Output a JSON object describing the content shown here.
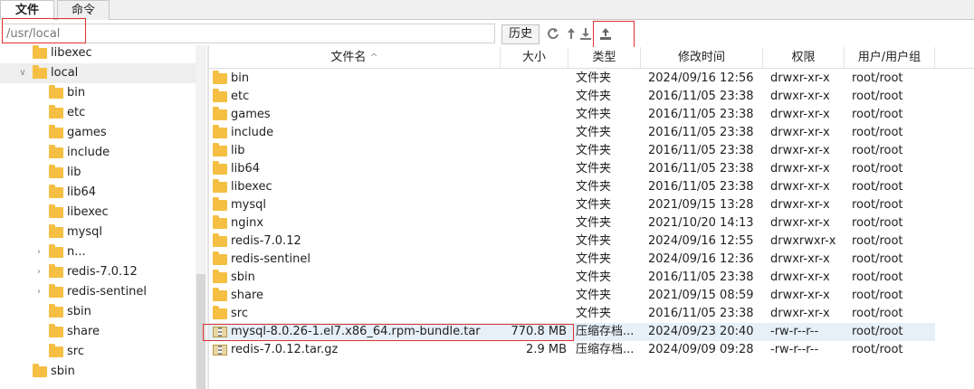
{
  "tabs": [
    "文件",
    "命令"
  ],
  "toolbar": {
    "path": "/usr/local",
    "history_label": "历史",
    "icons": [
      "refresh-icon",
      "up-arrow-icon",
      "download-icon",
      "upload-icon"
    ]
  },
  "tree": {
    "items": [
      {
        "label": "libexec",
        "level": 1,
        "caret": ""
      },
      {
        "label": "local",
        "level": 1,
        "caret": "open",
        "selected": true
      },
      {
        "label": "bin",
        "level": 2,
        "caret": ""
      },
      {
        "label": "etc",
        "level": 2,
        "caret": ""
      },
      {
        "label": "games",
        "level": 2,
        "caret": ""
      },
      {
        "label": "include",
        "level": 2,
        "caret": ""
      },
      {
        "label": "lib",
        "level": 2,
        "caret": ""
      },
      {
        "label": "lib64",
        "level": 2,
        "caret": ""
      },
      {
        "label": "libexec",
        "level": 2,
        "caret": ""
      },
      {
        "label": "mysql",
        "level": 2,
        "caret": ""
      },
      {
        "label": "n...",
        "level": 2,
        "caret": "closed"
      },
      {
        "label": "redis-7.0.12",
        "level": 2,
        "caret": "closed"
      },
      {
        "label": "redis-sentinel",
        "level": 2,
        "caret": "closed"
      },
      {
        "label": "sbin",
        "level": 2,
        "caret": ""
      },
      {
        "label": "share",
        "level": 2,
        "caret": ""
      },
      {
        "label": "src",
        "level": 2,
        "caret": ""
      },
      {
        "label": "sbin",
        "level": 1,
        "caret": ""
      }
    ]
  },
  "table": {
    "columns": [
      "文件名",
      "大小",
      "类型",
      "修改时间",
      "权限",
      "用户/用户组"
    ],
    "sort_indicator": "^",
    "rows": [
      {
        "name": "bin",
        "size": "",
        "type": "文件夹",
        "mtime": "2024/09/16 12:56",
        "perm": "drwxr-xr-x",
        "owner": "root/root",
        "icon": "folder"
      },
      {
        "name": "etc",
        "size": "",
        "type": "文件夹",
        "mtime": "2016/11/05 23:38",
        "perm": "drwxr-xr-x",
        "owner": "root/root",
        "icon": "folder"
      },
      {
        "name": "games",
        "size": "",
        "type": "文件夹",
        "mtime": "2016/11/05 23:38",
        "perm": "drwxr-xr-x",
        "owner": "root/root",
        "icon": "folder"
      },
      {
        "name": "include",
        "size": "",
        "type": "文件夹",
        "mtime": "2016/11/05 23:38",
        "perm": "drwxr-xr-x",
        "owner": "root/root",
        "icon": "folder"
      },
      {
        "name": "lib",
        "size": "",
        "type": "文件夹",
        "mtime": "2016/11/05 23:38",
        "perm": "drwxr-xr-x",
        "owner": "root/root",
        "icon": "folder"
      },
      {
        "name": "lib64",
        "size": "",
        "type": "文件夹",
        "mtime": "2016/11/05 23:38",
        "perm": "drwxr-xr-x",
        "owner": "root/root",
        "icon": "folder"
      },
      {
        "name": "libexec",
        "size": "",
        "type": "文件夹",
        "mtime": "2016/11/05 23:38",
        "perm": "drwxr-xr-x",
        "owner": "root/root",
        "icon": "folder"
      },
      {
        "name": "mysql",
        "size": "",
        "type": "文件夹",
        "mtime": "2021/09/15 13:28",
        "perm": "drwxr-xr-x",
        "owner": "root/root",
        "icon": "folder"
      },
      {
        "name": "nginx",
        "size": "",
        "type": "文件夹",
        "mtime": "2021/10/20 14:13",
        "perm": "drwxr-xr-x",
        "owner": "root/root",
        "icon": "folder"
      },
      {
        "name": "redis-7.0.12",
        "size": "",
        "type": "文件夹",
        "mtime": "2024/09/16 12:55",
        "perm": "drwxrwxr-x",
        "owner": "root/root",
        "icon": "folder"
      },
      {
        "name": "redis-sentinel",
        "size": "",
        "type": "文件夹",
        "mtime": "2024/09/16 12:36",
        "perm": "drwxr-xr-x",
        "owner": "root/root",
        "icon": "folder"
      },
      {
        "name": "sbin",
        "size": "",
        "type": "文件夹",
        "mtime": "2016/11/05 23:38",
        "perm": "drwxr-xr-x",
        "owner": "root/root",
        "icon": "folder"
      },
      {
        "name": "share",
        "size": "",
        "type": "文件夹",
        "mtime": "2021/09/15 08:59",
        "perm": "drwxr-xr-x",
        "owner": "root/root",
        "icon": "folder"
      },
      {
        "name": "src",
        "size": "",
        "type": "文件夹",
        "mtime": "2016/11/05 23:38",
        "perm": "drwxr-xr-x",
        "owner": "root/root",
        "icon": "folder"
      },
      {
        "name": "mysql-8.0.26-1.el7.x86_64.rpm-bundle.tar",
        "size": "770.8 MB",
        "type": "压缩存档...",
        "mtime": "2024/09/23 20:40",
        "perm": "-rw-r--r--",
        "owner": "root/root",
        "icon": "archive",
        "selected": true
      },
      {
        "name": "redis-7.0.12.tar.gz",
        "size": "2.9 MB",
        "type": "压缩存档...",
        "mtime": "2024/09/09 09:28",
        "perm": "-rw-r--r--",
        "owner": "root/root",
        "icon": "archive"
      }
    ]
  },
  "colors": {
    "folder": "#f4bf42",
    "highlight_box": "#e03030",
    "selected_row": "#e6f0f8"
  }
}
